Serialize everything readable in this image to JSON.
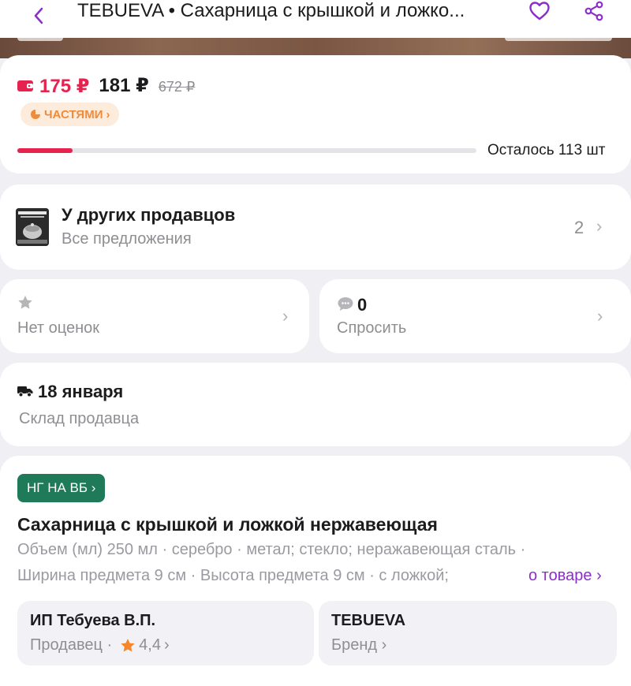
{
  "header": {
    "title": "TEBUEVA • Сахарница с крышкой и ложко..."
  },
  "price": {
    "wallet_price": "175 ₽",
    "main_price": "181 ₽",
    "old_price": "672 ₽",
    "parts_label": "ЧАСТЯМИ",
    "parts_chevron": "›",
    "stock_fraction": 0.12,
    "stock_text": "Осталось 113 шт"
  },
  "sellers": {
    "title": "У других продавцов",
    "subtitle": "Все предложения",
    "count": "2",
    "chevron": "›"
  },
  "rating": {
    "label": "Нет оценок",
    "chevron": "›"
  },
  "questions": {
    "count": "0",
    "label": "Спросить",
    "chevron": "›"
  },
  "delivery": {
    "date": "18 января",
    "source": "Склад продавца"
  },
  "product": {
    "badge": "НГ НА ВБ ›",
    "title": "Сахарница с крышкой и ложкой нержавеющая",
    "spec_line_1": "Объем (мл) 250 мл · серебро · метал; стекло; неражавеющая сталь ·",
    "spec_line_2": "Ширина предмета 9 см · Высота предмета 9 см · с ложкой;",
    "about_link": "о товаре ›"
  },
  "seller_tile": {
    "name": "ИП Тебуева В.П.",
    "role": "Продавец ·",
    "rating": "4,4",
    "chevron": "›"
  },
  "brand_tile": {
    "name": "TEBUEVA",
    "label": "Бренд ›"
  },
  "colors": {
    "accent_purple": "#8b2fc9",
    "price_red": "#e6224e",
    "badge_green": "#1f7a5a",
    "parts_orange": "#f08b3a",
    "star_orange": "#f6862a"
  }
}
